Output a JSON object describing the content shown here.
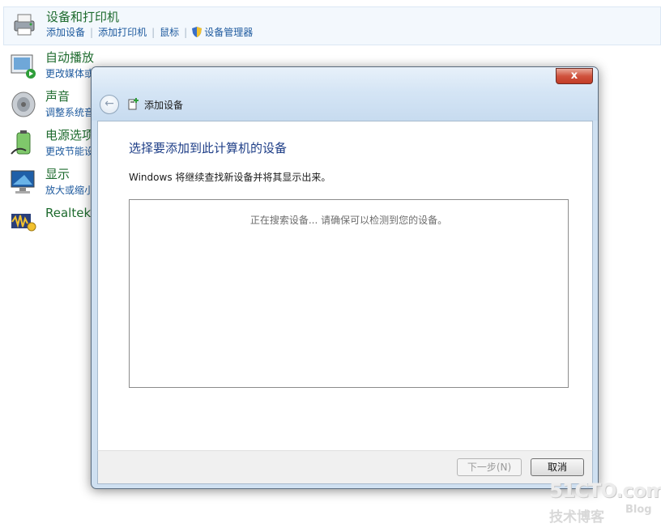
{
  "control_panel": {
    "items": [
      {
        "title": "设备和打印机",
        "links": [
          "添加设备",
          "添加打印机",
          "鼠标",
          "设备管理器"
        ]
      },
      {
        "title": "自动播放",
        "links": [
          "更改媒体或"
        ]
      },
      {
        "title": "声音",
        "links": [
          "调整系统音"
        ]
      },
      {
        "title": "电源选项",
        "links": [
          "更改节能设"
        ]
      },
      {
        "title": "显示",
        "links": [
          "放大或缩小"
        ]
      },
      {
        "title": "Realtek"
      }
    ]
  },
  "dialog": {
    "close_label": "x",
    "wizard_title": "添加设备",
    "heading": "选择要添加到此计算机的设备",
    "description": "Windows 将继续查找新设备并将其显示出来。",
    "status": "正在搜索设备... 请确保可以检测到您的设备。",
    "next_label": "下一步(N)",
    "cancel_label": "取消"
  },
  "watermark": {
    "line1": "51CTO.com",
    "line2": "技术博客",
    "line3": "Blog"
  },
  "colors": {
    "title_green": "#1e6b2e",
    "link_blue": "#1e5a9e",
    "heading_blue": "#1e3e87",
    "close_red": "#c23b26"
  }
}
